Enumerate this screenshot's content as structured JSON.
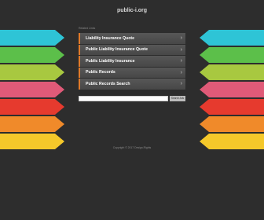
{
  "site": {
    "title": "public-i.org"
  },
  "related_label": "Related Links",
  "links": [
    {
      "label": "Liability Insurance Quote"
    },
    {
      "label": "Public Liability Insurance Quote"
    },
    {
      "label": "Public Liability Insurance"
    },
    {
      "label": "Public Records"
    },
    {
      "label": "Public Records Search"
    }
  ],
  "chevron_glyph": "›",
  "search": {
    "value": "",
    "placeholder": "",
    "button_label": "Search Ads"
  },
  "footer": {
    "text": "Copyright © 2017 Design.Rights"
  },
  "colors": {
    "background": "#2d2d2d",
    "accent": "#e07a2a",
    "wing_colors": [
      "#2ec4d6",
      "#5cbf4a",
      "#a8c840",
      "#e05a78",
      "#e63a2e",
      "#f08a2a",
      "#f5c82a"
    ]
  }
}
